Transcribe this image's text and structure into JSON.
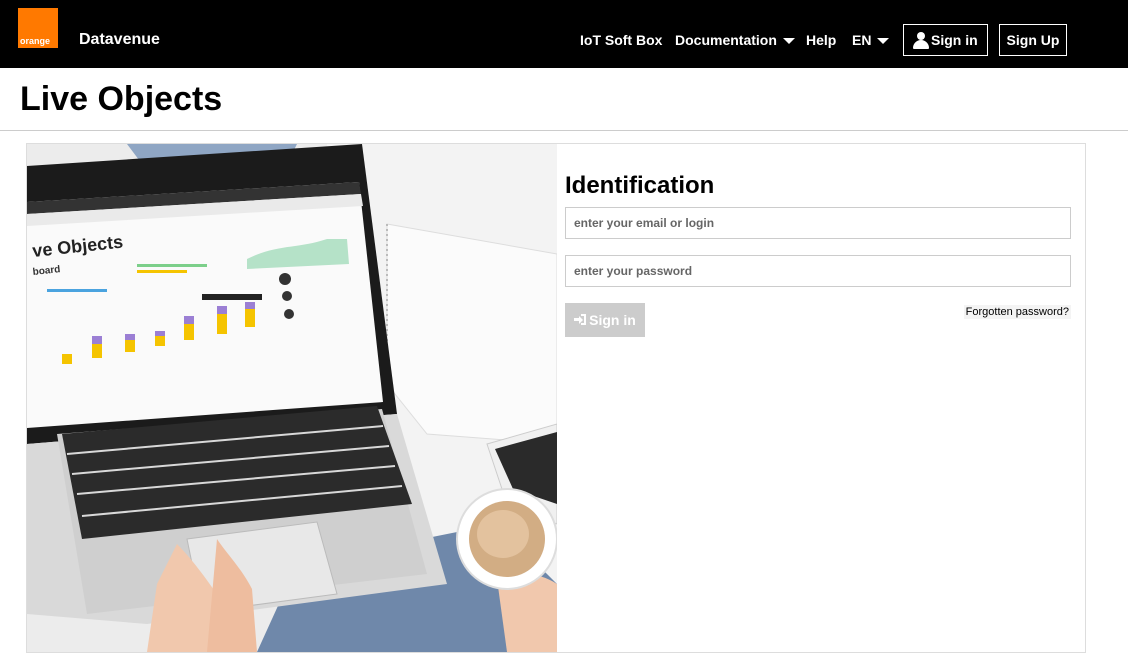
{
  "header": {
    "logo_text": "orange",
    "brand": "Datavenue",
    "nav": {
      "iot_soft_box": "IoT Soft Box",
      "documentation": "Documentation",
      "help": "Help",
      "language": "EN",
      "sign_in": "Sign in",
      "sign_up": "Sign Up"
    }
  },
  "page": {
    "title": "Live Objects"
  },
  "hero_screen": {
    "title": "ve Objects",
    "subtitle": "board"
  },
  "login": {
    "title": "Identification",
    "email_placeholder": "enter your email or login",
    "password_placeholder": "enter your password",
    "submit_label": "Sign in",
    "forgot_label": "Forgotten password?"
  },
  "colors": {
    "brand_orange": "#ff7900",
    "topbar": "#000000",
    "button_disabled": "#cccccc"
  }
}
